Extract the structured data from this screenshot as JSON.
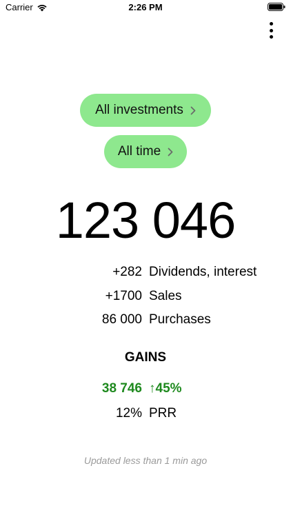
{
  "status_bar": {
    "carrier": "Carrier",
    "time": "2:26 PM",
    "wifi_icon": "wifi-icon",
    "battery_icon": "battery-icon"
  },
  "header": {
    "more_icon": "vertical-ellipsis-icon"
  },
  "filters": {
    "portfolio_label": "All investments",
    "period_label": "All time",
    "pill_color": "#8ee88e"
  },
  "summary": {
    "total": "123 046",
    "rows": [
      {
        "value": "+282",
        "label": "Dividends, interest"
      },
      {
        "value": "+1700",
        "label": "Sales"
      },
      {
        "value": "86 000",
        "label": "Purchases"
      }
    ]
  },
  "gains": {
    "heading": "GAINS",
    "amount": "38 746",
    "percent": "↑45%",
    "color": "#1f8a1f",
    "prr_value": "12%",
    "prr_label": "PRR"
  },
  "footer": {
    "updated_text": "Updated less than 1 min ago"
  }
}
